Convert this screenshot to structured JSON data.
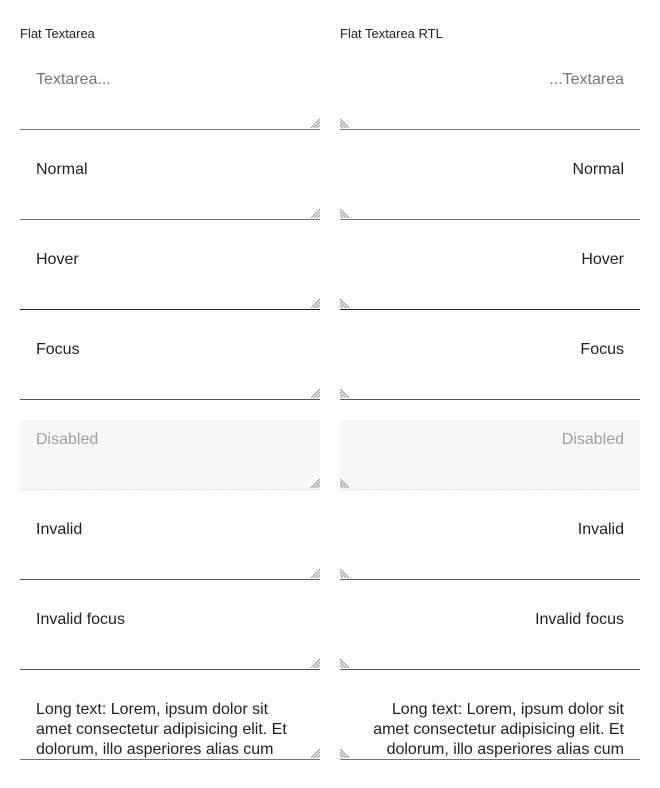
{
  "columns": [
    {
      "title": "Flat Textarea",
      "items": [
        {
          "text": "Textarea..."
        },
        {
          "text": "Normal"
        },
        {
          "text": "Hover"
        },
        {
          "text": "Focus"
        },
        {
          "text": "Disabled"
        },
        {
          "text": "Invalid"
        },
        {
          "text": "Invalid focus"
        },
        {
          "text": "Long text: Lorem, ipsum dolor sit amet consectetur adipisicing elit. Et dolorum, illo asperiores alias cum"
        }
      ]
    },
    {
      "title": "Flat Textarea RTL",
      "items": [
        {
          "text": "...Textarea"
        },
        {
          "text": "Normal"
        },
        {
          "text": "Hover"
        },
        {
          "text": "Focus"
        },
        {
          "text": "Disabled"
        },
        {
          "text": "Invalid"
        },
        {
          "text": "Invalid focus"
        },
        {
          "text": "Long text: Lorem, ipsum dolor sit amet consectetur adipisicing elit. Et dolorum, illo asperiores alias cum"
        }
      ]
    }
  ],
  "icons": {
    "resize_handle": "resize-grip-icon"
  },
  "colors": {
    "border_default": "#757575",
    "border_hover": "#212121",
    "border_focus": "#3f51b5",
    "border_invalid": "#c62828",
    "disabled_background": "#f8f8f8",
    "placeholder_text": "#757575"
  }
}
